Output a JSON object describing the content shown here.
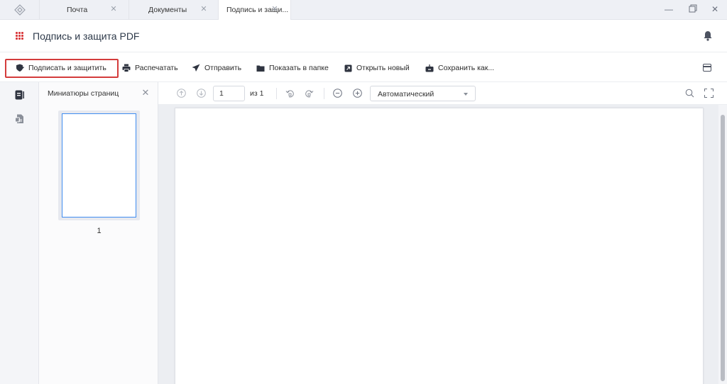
{
  "tabs": [
    {
      "label": "Почта",
      "active": false
    },
    {
      "label": "Документы",
      "active": false
    },
    {
      "label": "Подпись и защи...",
      "active": true
    }
  ],
  "window_controls": {
    "minimize": "minimize-icon",
    "restore": "restore-icon",
    "close": "close-icon"
  },
  "header": {
    "title": "Подпись и защита PDF"
  },
  "toolbar": {
    "sign": "Подписать и защитить",
    "print": "Распечатать",
    "send": "Отправить",
    "show_in_folder": "Показать в папке",
    "open_new": "Открыть новый",
    "save_as": "Сохранить как..."
  },
  "thumbnails": {
    "title": "Миниатюры страниц",
    "pages": [
      "1"
    ]
  },
  "viewer": {
    "page_value": "1",
    "page_of": "из 1",
    "zoom": "Автоматический"
  },
  "colors": {
    "accent": "#d9393c",
    "highlight": "#d43c3c",
    "thumb_border": "#3f8cf0"
  }
}
